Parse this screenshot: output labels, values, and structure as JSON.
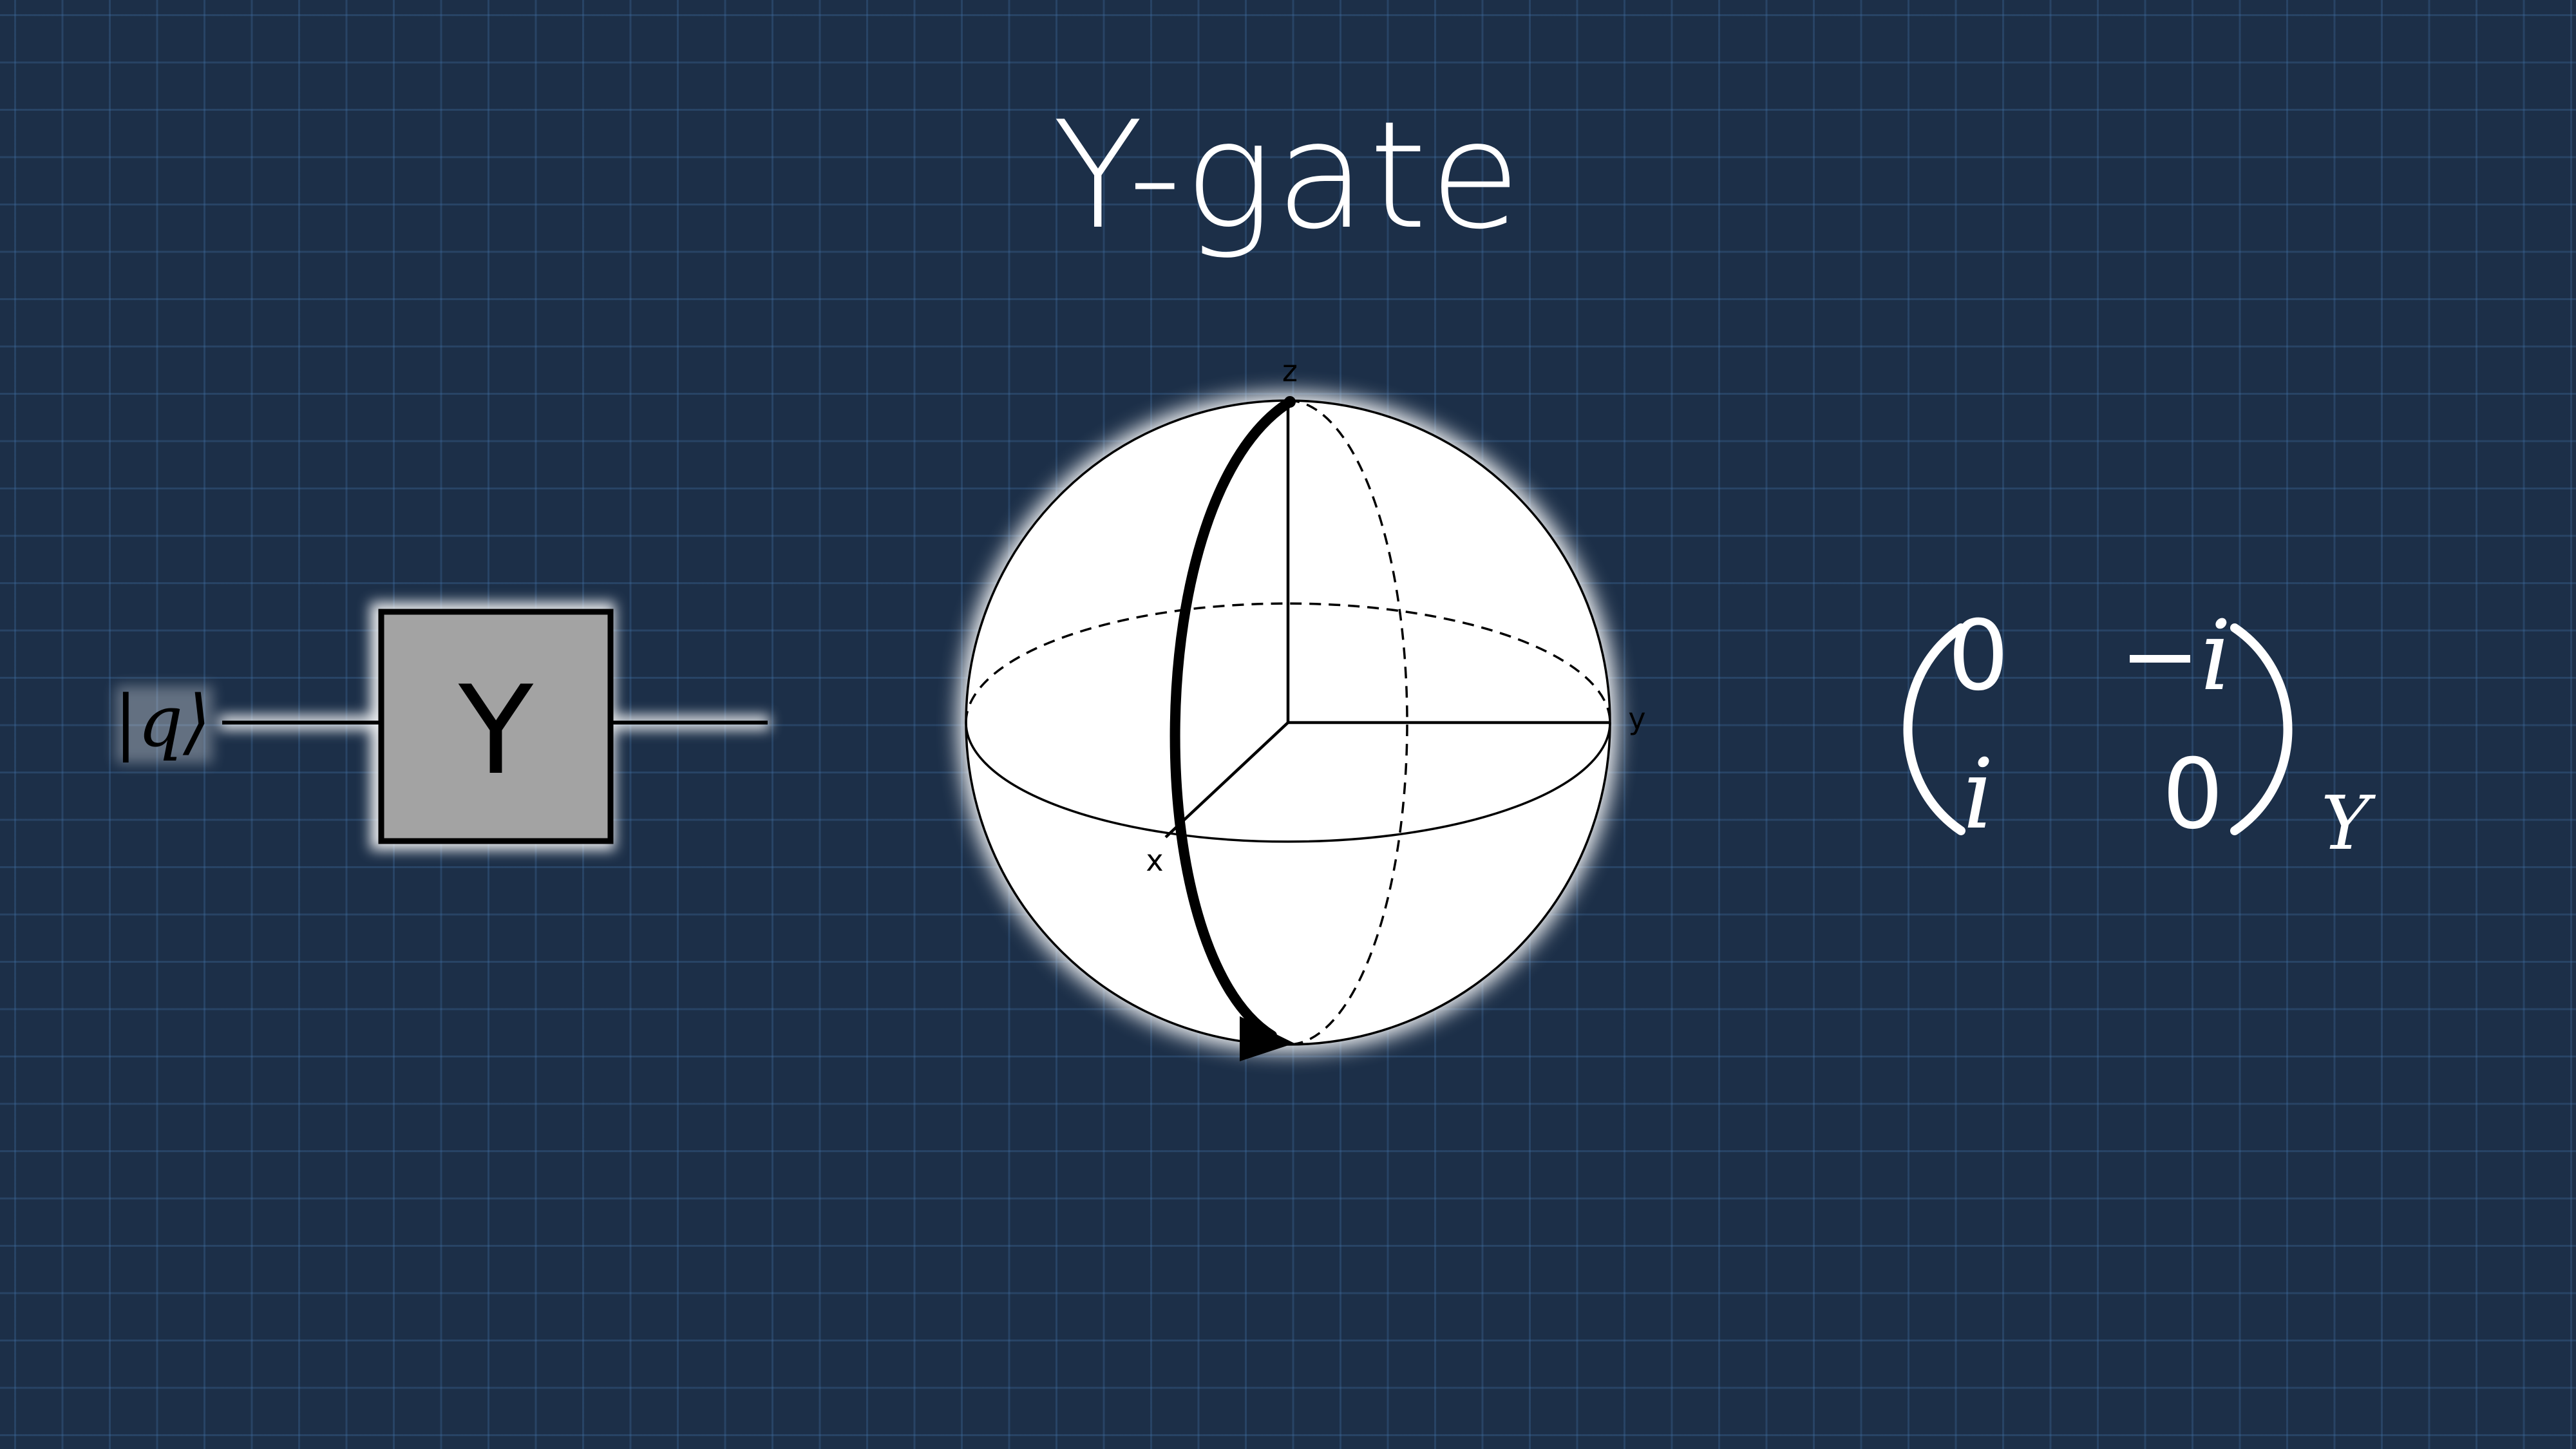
{
  "title": "Y-gate",
  "circuit": {
    "input_label": "|q⟩",
    "gate_label": "Y",
    "colors": {
      "gate_fill": "#a3a3a3",
      "gate_border": "#000000",
      "wire": "#000000",
      "glow": "#ffffff"
    }
  },
  "bloch_sphere": {
    "axis_labels": {
      "z": "z",
      "y": "y",
      "x": "x"
    },
    "rotation": "z to -z about y-axis",
    "colors": {
      "sphere": "#ffffff",
      "arrow": "#000000"
    }
  },
  "matrix": {
    "cells": [
      [
        "0",
        "−i"
      ],
      [
        "i",
        "0"
      ]
    ],
    "subscript": "Y",
    "color": "#ffffff"
  }
}
